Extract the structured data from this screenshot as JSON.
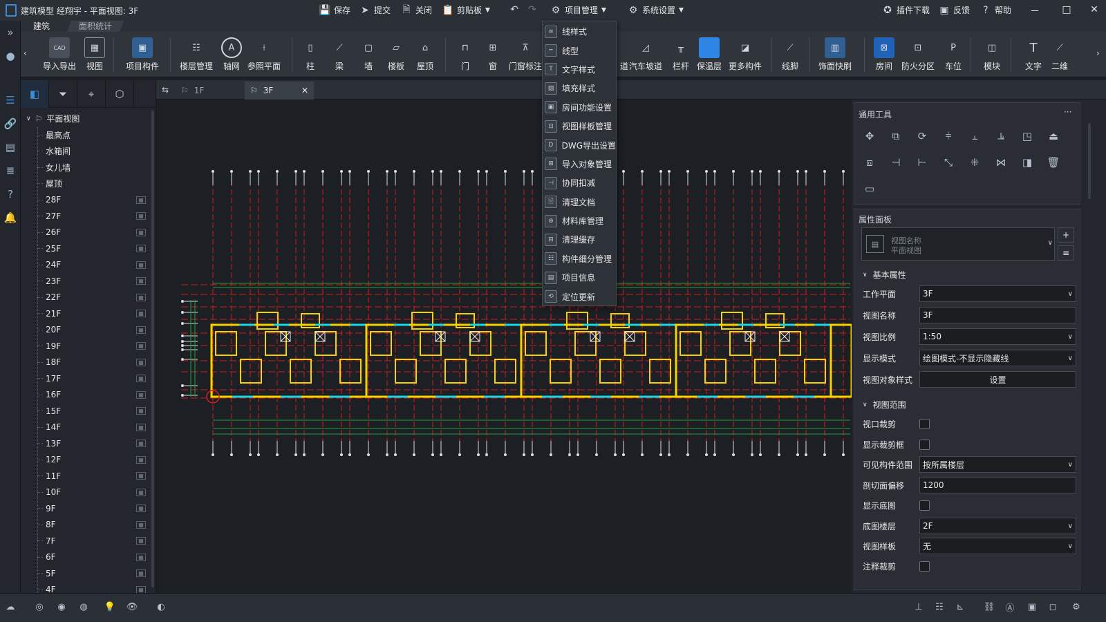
{
  "window": {
    "title": "建筑模型 经翔宇 - 平面视图: 3F",
    "toolbar": [
      "保存",
      "提交",
      "关闭",
      "剪贴板",
      "项目管理",
      "系统设置"
    ],
    "right_actions": [
      "插件下载",
      "反馈",
      "帮助"
    ],
    "controls": [
      "－",
      "□",
      "✕"
    ]
  },
  "ribbon": {
    "tabs": [
      "建筑",
      "面积统计"
    ],
    "items": [
      "导入导出",
      "视图",
      "项目构件",
      "楼层管理",
      "轴网",
      "参照平面",
      "柱",
      "梁",
      "墙",
      "楼板",
      "屋顶",
      "门",
      "窗",
      "门窗标注",
      "道",
      "汽车坡道",
      "栏杆",
      "保温层",
      "更多构件",
      "线脚",
      "饰面快刷",
      "房间",
      "防火分区",
      "车位",
      "模块",
      "文字",
      "二维"
    ]
  },
  "project_menu": {
    "items": [
      "线样式",
      "线型",
      "文字样式",
      "填充样式",
      "房间功能设置",
      "视图样板管理",
      "DWG导出设置",
      "导入对象管理",
      "协同扣减",
      "清理文档",
      "材料库管理",
      "清理缓存",
      "构件细分管理",
      "项目信息",
      "定位更新"
    ]
  },
  "tree": {
    "root": "平面视图",
    "items": [
      "最高点",
      "水箱间",
      "女儿墙",
      "屋顶",
      "28F",
      "27F",
      "26F",
      "25F",
      "24F",
      "23F",
      "22F",
      "21F",
      "20F",
      "19F",
      "18F",
      "17F",
      "16F",
      "15F",
      "14F",
      "13F",
      "12F",
      "11F",
      "10F",
      "9F",
      "8F",
      "7F",
      "6F",
      "5F",
      "4F"
    ]
  },
  "view_tabs": [
    "1F",
    "3F"
  ],
  "general_tools": {
    "title": "通用工具",
    "more": "···"
  },
  "properties": {
    "title": "属性面板",
    "type_name": "视图名称",
    "type_sub": "平面视图",
    "group_basic": "基本属性",
    "group_range": "视图范围",
    "rows": {
      "work_plane": {
        "label": "工作平面",
        "value": "3F"
      },
      "view_name": {
        "label": "视图名称",
        "value": "3F"
      },
      "scale": {
        "label": "视图比例",
        "value": "1:50"
      },
      "display_mode": {
        "label": "显示模式",
        "value": "绘图模式-不显示隐藏线"
      },
      "object_style": {
        "label": "视图对象样式",
        "value": "设置"
      },
      "crop": {
        "label": "视口裁剪"
      },
      "show_crop": {
        "label": "显示裁剪框"
      },
      "visible_range": {
        "label": "可见构件范围",
        "value": "按所属楼层"
      },
      "cut_offset": {
        "label": "剖切面偏移",
        "value": "1200"
      },
      "show_underlay": {
        "label": "显示底图"
      },
      "underlay_level": {
        "label": "底图楼层",
        "value": "2F"
      },
      "template": {
        "label": "视图样板",
        "value": "无"
      },
      "annot_crop": {
        "label": "注释裁剪"
      }
    }
  },
  "colors": {
    "accent": "#3b8bd9",
    "wall": "#f5d300",
    "grid": "#d21e1e",
    "green": "#1fa03a",
    "cyan": "#19d6e6"
  }
}
